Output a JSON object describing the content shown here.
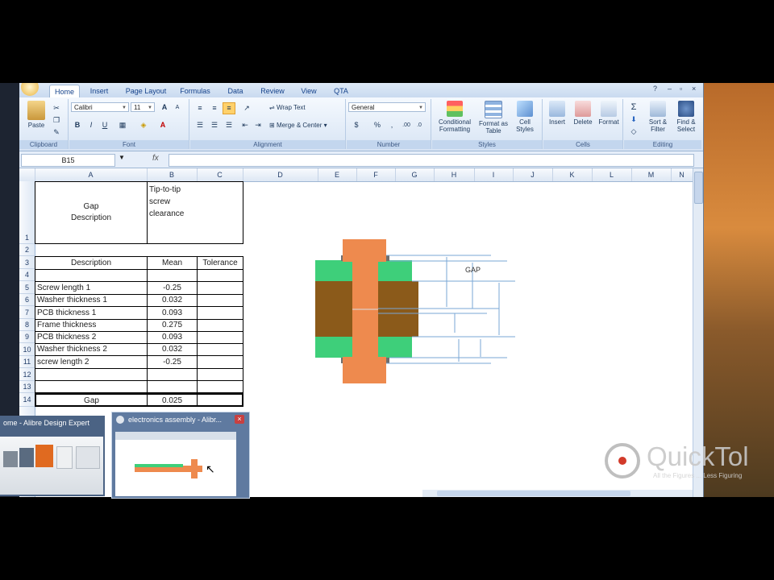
{
  "ribbon_tabs": [
    "Home",
    "Insert",
    "Page Layout",
    "Formulas",
    "Data",
    "Review",
    "View",
    "QTA"
  ],
  "clipboard": {
    "paste": "Paste",
    "label": "Clipboard"
  },
  "font": {
    "name": "Calibri",
    "size": "11",
    "label": "Font",
    "bold": "B",
    "italic": "I",
    "underline": "U",
    "grow": "A",
    "shrink": "A"
  },
  "alignment": {
    "wrap_text": "Wrap Text",
    "merge_center": "Merge & Center",
    "label": "Alignment"
  },
  "number": {
    "format": "General",
    "currency": "$",
    "percent": "%",
    "comma": ",",
    "label": "Number"
  },
  "styles": {
    "conditional": "Conditional Formatting",
    "as_table": "Format as Table",
    "cell_styles": "Cell Styles",
    "label": "Styles"
  },
  "cells": {
    "insert": "Insert",
    "delete": "Delete",
    "format": "Format",
    "label": "Cells"
  },
  "editing": {
    "sum": "Σ",
    "sort": "Sort & Filter",
    "find": "Find & Select",
    "label": "Editing"
  },
  "formula_bar": {
    "name_box": "B15",
    "fx": "fx",
    "value": ""
  },
  "columns": [
    "A",
    "B",
    "C",
    "D",
    "E",
    "F",
    "G",
    "H",
    "I",
    "J",
    "K",
    "L",
    "M",
    "N"
  ],
  "rows": [
    "1",
    "2",
    "3",
    "4",
    "5",
    "6",
    "7",
    "8",
    "9",
    "10",
    "11",
    "12",
    "13",
    "14"
  ],
  "sheet": {
    "a1_line1": "Gap",
    "a1_line2": "Description",
    "b1": "Tip-to-tip screw clearance",
    "header": {
      "description": "Description",
      "mean": "Mean",
      "tolerance": "Tolerance"
    },
    "items": [
      {
        "desc": "Screw length 1",
        "mean": "-0.25"
      },
      {
        "desc": "Washer thickness 1",
        "mean": "0.032"
      },
      {
        "desc": "PCB thickness 1",
        "mean": "0.093"
      },
      {
        "desc": "Frame thickness",
        "mean": "0.275"
      },
      {
        "desc": "PCB thickness 2",
        "mean": "0.093"
      },
      {
        "desc": "Washer thickness 2",
        "mean": "0.032"
      },
      {
        "desc": "screw length 2",
        "mean": "-0.25"
      }
    ],
    "total": {
      "desc": "Gap",
      "mean": "0.025"
    }
  },
  "diagram": {
    "gap_label": "GAP"
  },
  "taskbar": {
    "preview1_title": "ome - Alibre Design Expert",
    "preview2_title": "electronics assembly - Alibr..."
  },
  "watermark": {
    "brand": "QuickTol",
    "tagline": "All the Figures ... Less Figuring"
  },
  "colors": {
    "orange": "#ee8a4e",
    "green": "#3ecf7a",
    "brown": "#8b5a1a",
    "gray": "#6f6f6f",
    "dim_line": "#7aa7d6"
  }
}
